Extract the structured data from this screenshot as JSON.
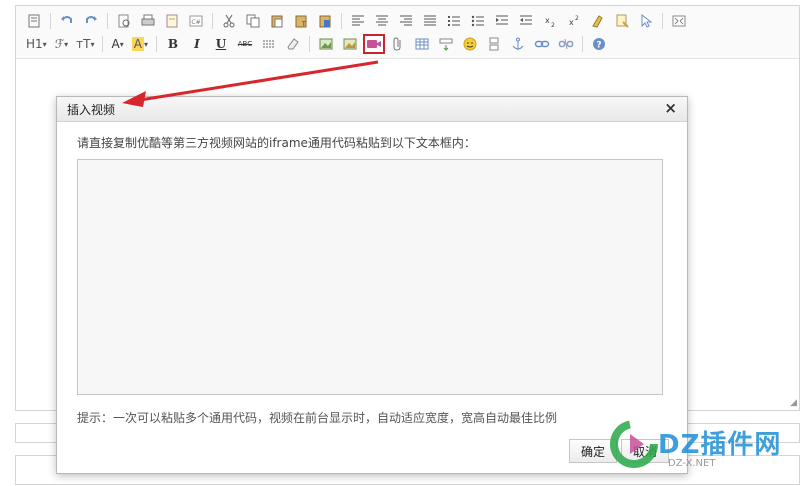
{
  "toolbar": {
    "row1": [
      "source-code-icon",
      "undo-icon",
      "redo-icon",
      "preview-icon",
      "print-icon",
      "template-icon",
      "html-icon",
      "cut-icon",
      "copy-icon",
      "paste-icon",
      "paste-text-icon",
      "paste-word-icon",
      "align-left-icon",
      "align-center-icon",
      "align-right-icon",
      "align-justify-icon",
      "ordered-list-icon",
      "unordered-list-icon",
      "indent-icon",
      "outdent-icon",
      "subscript-icon",
      "superscript-icon",
      "clear-format-icon",
      "select-all-icon",
      "cursor-icon",
      "fullscreen-icon"
    ],
    "row2": {
      "heading_label": "H1",
      "font_family_label": "ℱ",
      "font_size_label": "тT",
      "font_color_label": "A",
      "bg_color_label": "A",
      "bold_label": "B",
      "italic_label": "I",
      "underline_label": "U",
      "strike_label": "ABC"
    }
  },
  "dialog": {
    "title": "插入视频",
    "close_label": "×",
    "instruction": "请直接复制优酷等第三方视频网站的iframe通用代码粘贴到以下文本框内：",
    "textarea_value": "",
    "tip": "提示：一次可以粘贴多个通用代码，视频在前台显示时，自动适应宽度，宽高自动最佳比例",
    "ok_label": "确定",
    "cancel_label": "取消"
  },
  "watermark": {
    "brand": "DZ插件网",
    "url": "DZ-X.NET"
  },
  "colors": {
    "annotation_red": "#d9262c",
    "highlight_border": "#c9252e",
    "brand_blue": "#1d8fd6"
  }
}
